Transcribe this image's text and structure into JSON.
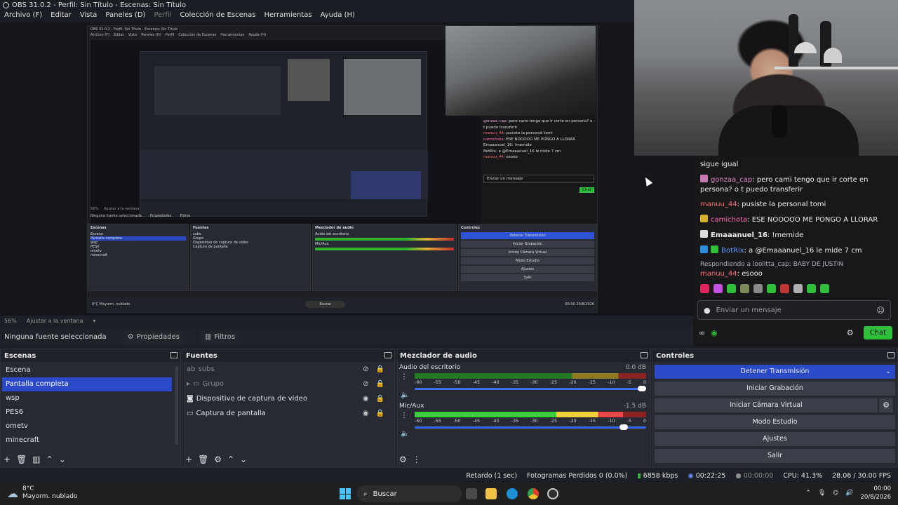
{
  "window": {
    "title": "OBS 31.0.2 - Perfil: Sin Título - Escenas: Sin Título"
  },
  "menu": [
    "Archivo (F)",
    "Editar",
    "Vista",
    "Paneles (D)",
    "Perfil",
    "Colección de Escenas",
    "Herramientas",
    "Ayuda (H)"
  ],
  "nested": {
    "title": "OBS 31.0.2 - Perfil: Sin Título - Escenas: Sin Título",
    "menu": [
      "Archivo (F)",
      "Editar",
      "Vista",
      "Paneles (D)",
      "Perfil",
      "Colección de Escenas",
      "Herramientas",
      "Ayuda (H)"
    ],
    "zoom": "56%",
    "fit": "Ajustar a la ventana",
    "no_source": "Ninguna fuente seleccionada",
    "props": "Propiedades",
    "filters": "Filtros",
    "scenes_title": "Escenas",
    "sources_title": "Fuentes",
    "mixer_title": "Mezclador de audio",
    "controls_title": "Controles",
    "chat": [
      {
        "user": "gonzaa_cap",
        "text": ": pero cami tengo que ir corte en persona? o t puedo transferir"
      },
      {
        "user": "manuu_44",
        "text": ": pusiste la personal tomi"
      },
      {
        "user": "camichota",
        "text": ": ESE NOOOOO ME PONGO A LLORAR"
      },
      {
        "user": "Emaaanuel_16",
        "text": ": !memide"
      },
      {
        "user": "BotRix",
        "text": ": a @Emaaanuel_16 le mide 7 cm"
      },
      {
        "user": "manuu_44",
        "text": ": esooo"
      }
    ],
    "chat_placeholder": "Enviar un mensaje",
    "chat_button": "Chat",
    "taskbar_search": "Buscar",
    "weather": "8°C",
    "weather_desc": "Mayorm. nublado",
    "time": "00:00",
    "date": "20/8/2026"
  },
  "chat": {
    "partial": "sigue igual",
    "messages": [
      {
        "user": "gonzaa_cap",
        "text": ": pero cami tengo que ir corte en persona? o t puedo transferir",
        "color": "#e08ec3"
      },
      {
        "user": "manuu_44",
        "text": ": pusiste la personal tomi",
        "color": "#ff6b6b"
      },
      {
        "user": "camichota",
        "text": ": ESE NOOOOO ME PONGO A LLORAR",
        "color": "#ff69b4"
      },
      {
        "user": "Emaaanuel_16",
        "text": ": !memide",
        "color": "#efeff1"
      },
      {
        "user": "BotRix",
        "text": ": a @Emaaanuel_16 le mide 7 cm",
        "color": "#5e9bff"
      }
    ],
    "reply_note": "Respondiendo a loolitta_cap: BABY DE JUSTIN",
    "last": {
      "user": "manuu_44",
      "text": ": esooo",
      "color": "#ff6b6b"
    },
    "placeholder": "Enviar un mensaje",
    "button": "Chat"
  },
  "zoombar": {
    "zoom": "56%",
    "fit": "Ajustar a la ventana"
  },
  "sourcebar": {
    "no_source": "Ninguna fuente seleccionada",
    "props": "Propiedades",
    "filters": "Filtros"
  },
  "scenes": {
    "title": "Escenas",
    "items": [
      "Escena",
      "Pantalla completa",
      "wsp",
      "PES6",
      "ometv",
      "minecraft"
    ],
    "selected_index": 1
  },
  "sources": {
    "title": "Fuentes",
    "items": [
      {
        "label": "subs",
        "visible": false
      },
      {
        "label": "Grupo",
        "visible": false
      },
      {
        "label": "Dispositivo de captura de video",
        "visible": true
      },
      {
        "label": "Captura de pantalla",
        "visible": true
      }
    ]
  },
  "mixer": {
    "title": "Mezclador de audio",
    "ticks": [
      "-60",
      "-55",
      "-50",
      "-45",
      "-40",
      "-35",
      "-30",
      "-25",
      "-20",
      "-15",
      "-10",
      "-5",
      "0"
    ],
    "channels": [
      {
        "name": "Audio del escritorio",
        "db": "0.0 dB",
        "level": 0.0,
        "volume": 1.0
      },
      {
        "name": "Mic/Aux",
        "db": "-1.5 dB",
        "level": 0.9,
        "volume": 0.92
      }
    ]
  },
  "controls": {
    "title": "Controles",
    "buttons": [
      "Detener Transmisión",
      "Iniciar Grabación",
      "Iniciar Cámara Virtual",
      "Modo Estudio",
      "Ajustes",
      "Salir"
    ]
  },
  "status": {
    "delay": "Retardo (1 sec)",
    "dropped": "Fotogramas Perdidos 0 (0.0%)",
    "bitrate": "6858 kbps",
    "stream_time": "00:22:25",
    "rec_time": "00:00:00",
    "cpu": "CPU: 41.3%",
    "fps": "28.06 / 30.00 FPS"
  },
  "taskbar": {
    "temp": "8°C",
    "weather": "Mayorm. nublado",
    "search": "Buscar",
    "time": "00:00",
    "date": "20/8/2026"
  },
  "colors": {
    "accent": "#2b4ac7",
    "chat_green": "#2fbf3a"
  }
}
